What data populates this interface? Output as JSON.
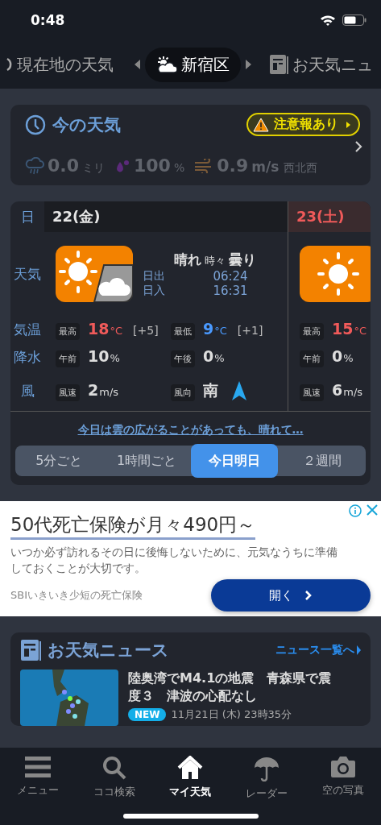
{
  "status_bar": {
    "time": "0:48"
  },
  "location_tabs": [
    {
      "label": "現在地の天気",
      "selected": false,
      "kind": "current"
    },
    {
      "label": "新宿区",
      "selected": true,
      "kind": "weather"
    },
    {
      "label": "お天気ニュ",
      "selected": false,
      "kind": "news"
    }
  ],
  "now": {
    "title": "今の天気",
    "alert": "注意報あり",
    "precip": {
      "value": "0.0",
      "unit": "ミリ"
    },
    "humidity": {
      "value": "100",
      "unit": "%"
    },
    "wind": {
      "value": "0.9",
      "unit": "m/s",
      "direction": "西北西"
    }
  },
  "forecast": {
    "row_labels": [
      "日",
      "天気",
      "気温",
      "降水",
      "風"
    ],
    "days": [
      {
        "date": "22(金)",
        "weekend": false,
        "kind": "sun_cloud",
        "weather": "**晴れ** 時々 **曇り**",
        "sunrise_label": "日出",
        "sunrise": "06:24",
        "sunset_label": "日入",
        "sunset": "16:31",
        "high_label": "最高",
        "high": "18",
        "high_unit": "°C",
        "high_diff": "[+5]",
        "low_label": "最低",
        "low": "9",
        "low_unit": "°C",
        "low_diff": "[+1]",
        "am_label": "午前",
        "am": "10",
        "am_unit": "%",
        "pm_label": "午後",
        "pm": "0",
        "pm_unit": "%",
        "wind_label": "風速",
        "wind": "2",
        "wind_unit": "m/s",
        "dir_label": "風向",
        "dir": "南"
      },
      {
        "date": "23(土)",
        "weekend": true,
        "kind": "sun",
        "high_label": "最高",
        "high": "15",
        "high_unit": "°C",
        "am_label": "午前",
        "am": "0",
        "am_unit": "%",
        "wind_label": "風速",
        "wind": "6",
        "wind_unit": "m/s"
      }
    ],
    "summary_link": "今日は雲の広がることがあっても、晴れて…",
    "range_tabs": [
      {
        "label": "5分ごと",
        "selected": false
      },
      {
        "label": "1時間ごと",
        "selected": false
      },
      {
        "label": "今日明日",
        "selected": true
      },
      {
        "label": "２週間",
        "selected": false
      }
    ]
  },
  "ad": {
    "headline": "50代死亡保険が月々490円～",
    "body": "いつか必ず訪れるその日に後悔しないために、元気なうちに準備しておくことが大切です。",
    "advertiser": "SBIいきいき少短の死亡保険",
    "button": "開く"
  },
  "news": {
    "title": "お天気ニュース",
    "more": "ニュース一覧へ",
    "items": [
      {
        "headline": "陸奥湾でM4.1の地震　青森県で震度３　津波の心配なし",
        "badge": "NEW",
        "date": "11月21日 (木) 23時35分"
      }
    ]
  },
  "tab_bar": [
    {
      "label": "メニュー",
      "kind": "menu",
      "selected": false
    },
    {
      "label": "ココ検索",
      "kind": "search",
      "selected": false
    },
    {
      "label": "マイ天気",
      "kind": "home",
      "selected": true
    },
    {
      "label": "レーダー",
      "kind": "umbrella",
      "selected": false
    },
    {
      "label": "空の写真",
      "kind": "camera",
      "selected": false
    }
  ]
}
